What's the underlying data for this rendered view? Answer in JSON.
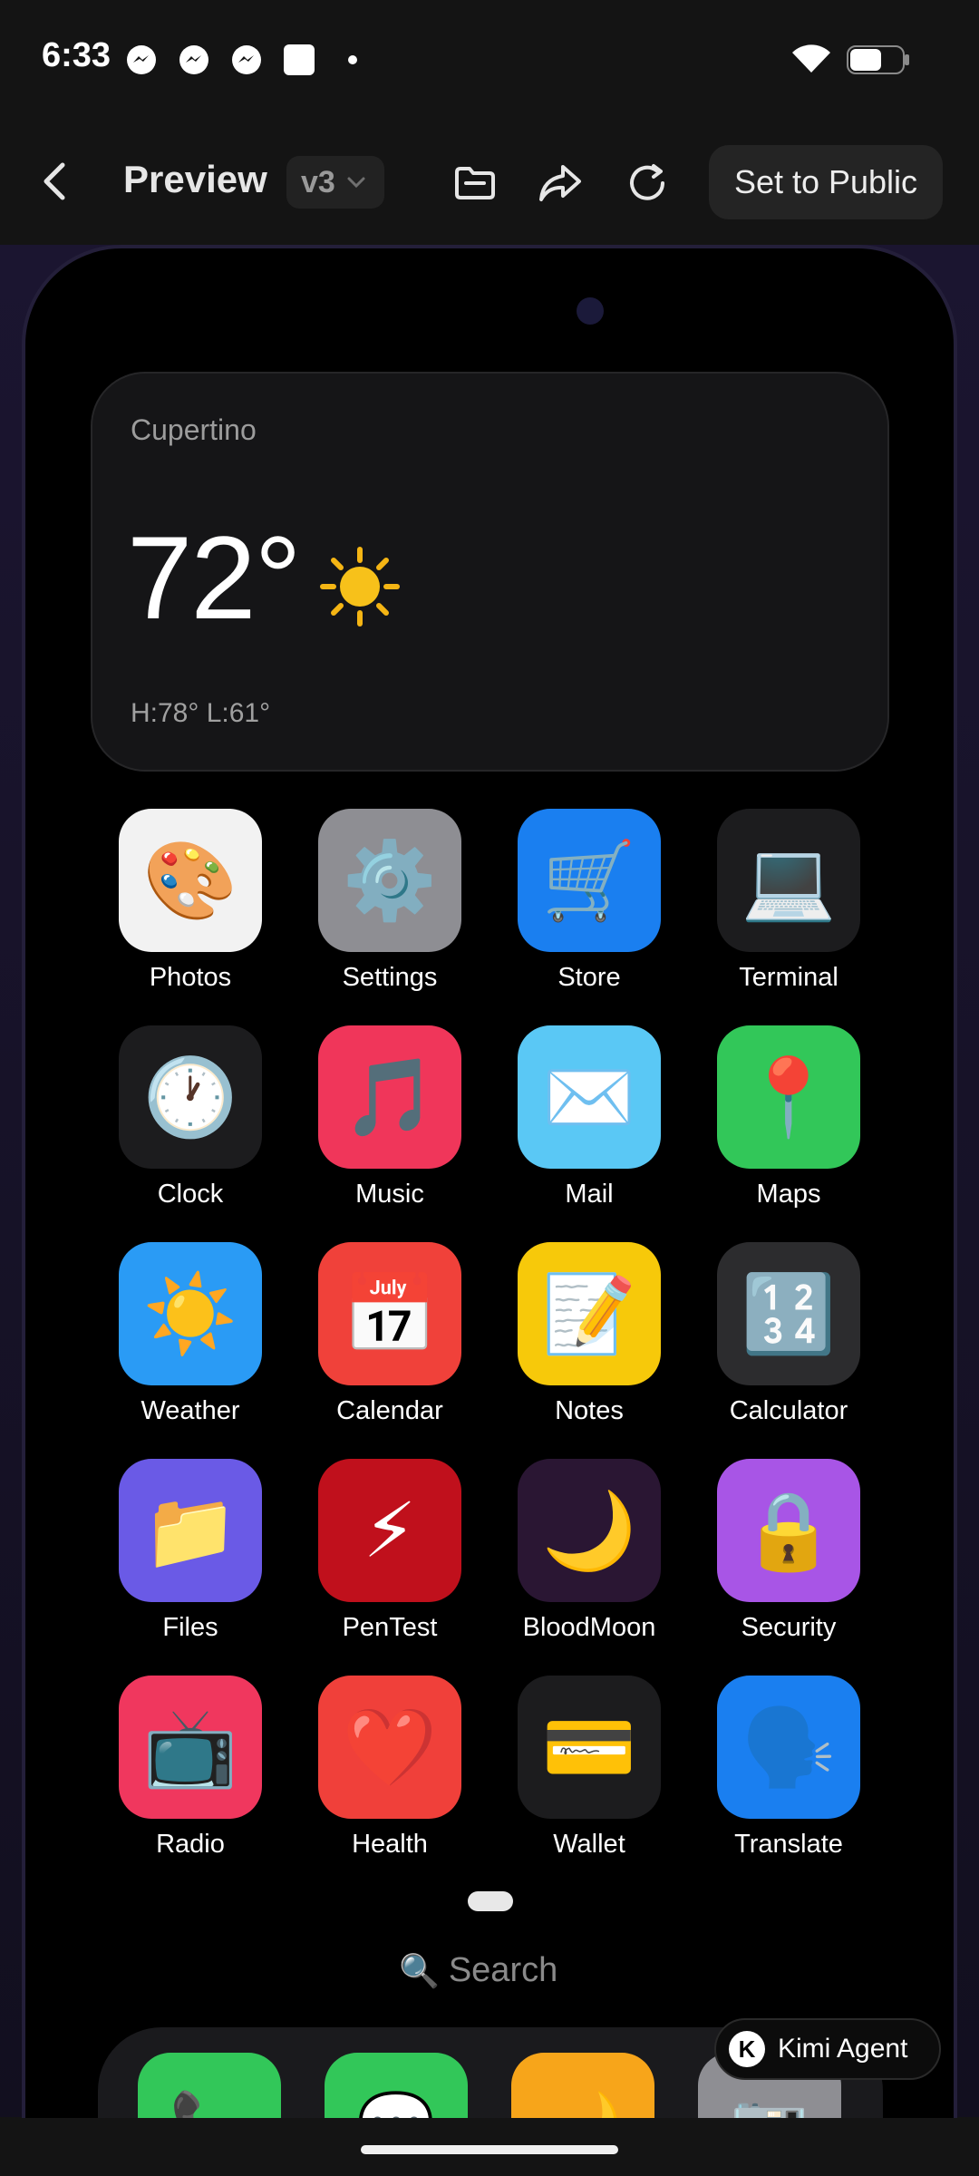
{
  "status_bar": {
    "time": "6:33",
    "notification_icons": [
      "messenger-icon",
      "messenger-icon",
      "messenger-icon",
      "square-app-icon",
      "dot-icon"
    ],
    "wifi_icon": "wifi-icon",
    "battery_icon": "battery-icon",
    "battery_level": 0.6
  },
  "header": {
    "back_icon": "chevron-left-icon",
    "title": "Preview",
    "version": "v3",
    "actions": [
      "folder-icon",
      "share-icon",
      "refresh-icon"
    ],
    "public_button": "Set to Public"
  },
  "weather": {
    "city": "Cupertino",
    "temperature": "72°",
    "icon": "sun-icon",
    "hi_lo": "H:78° L:61°"
  },
  "apps": [
    {
      "label": "Photos",
      "glyph": "🎨",
      "icon": "palette-icon",
      "color": "#f2f2f2"
    },
    {
      "label": "Settings",
      "glyph": "⚙️",
      "icon": "gear-icon",
      "color": "#8e8e93"
    },
    {
      "label": "Store",
      "glyph": "🛒",
      "icon": "cart-icon",
      "color": "#1a7ff0"
    },
    {
      "label": "Terminal",
      "glyph": "💻",
      "icon": "laptop-icon",
      "color": "#1c1c1e"
    },
    {
      "label": "Clock",
      "glyph": "🕐",
      "icon": "clock-icon",
      "color": "#1c1c1e"
    },
    {
      "label": "Music",
      "glyph": "🎵",
      "icon": "music-note-icon",
      "color": "#f0365a"
    },
    {
      "label": "Mail",
      "glyph": "✉️",
      "icon": "envelope-icon",
      "color": "#5ac8f5"
    },
    {
      "label": "Maps",
      "glyph": "📍",
      "icon": "pin-icon",
      "color": "#32c759"
    },
    {
      "label": "Weather",
      "glyph": "☀️",
      "icon": "sun-icon",
      "color": "#2a9bf5"
    },
    {
      "label": "Calendar",
      "glyph": "📅",
      "icon": "calendar-icon",
      "color": "#f0413a"
    },
    {
      "label": "Notes",
      "glyph": "📝",
      "icon": "memo-icon",
      "color": "#f7c90a"
    },
    {
      "label": "Calculator",
      "glyph": "🔢",
      "icon": "numbers-icon",
      "color": "#2c2c2e"
    },
    {
      "label": "Files",
      "glyph": "📁",
      "icon": "folder-icon",
      "color": "#6a5ae6"
    },
    {
      "label": "PenTest",
      "glyph": "⚡",
      "icon": "lightning-icon",
      "color": "#c0101c"
    },
    {
      "label": "BloodMoon",
      "glyph": "🌙",
      "icon": "moon-icon",
      "color": "#2a1633"
    },
    {
      "label": "Security",
      "glyph": "🔒",
      "icon": "lock-icon",
      "color": "#a855e6"
    },
    {
      "label": "Radio",
      "glyph": "📺",
      "icon": "tv-icon",
      "color": "#f0375e"
    },
    {
      "label": "Health",
      "glyph": "❤️",
      "icon": "heart-icon",
      "color": "#f0403a"
    },
    {
      "label": "Wallet",
      "glyph": "💳",
      "icon": "credit-card-icon",
      "color": "#1c1c1e"
    },
    {
      "label": "Translate",
      "glyph": "🗣️",
      "icon": "speaking-head-icon",
      "color": "#1a7ff0"
    }
  ],
  "search": {
    "label": "Search",
    "icon": "magnifier-icon"
  },
  "dock": [
    {
      "glyph": "📞",
      "icon": "phone-icon",
      "color": "#32c759"
    },
    {
      "glyph": "💬",
      "icon": "message-icon",
      "color": "#32c759"
    },
    {
      "glyph": "🌙",
      "icon": "moon-icon",
      "color": "#f7a51a"
    },
    {
      "glyph": "📷",
      "icon": "camera-icon",
      "color": "#8e8e93"
    }
  ],
  "kimi_agent": {
    "logo_letter": "K",
    "label": "Kimi Agent"
  }
}
